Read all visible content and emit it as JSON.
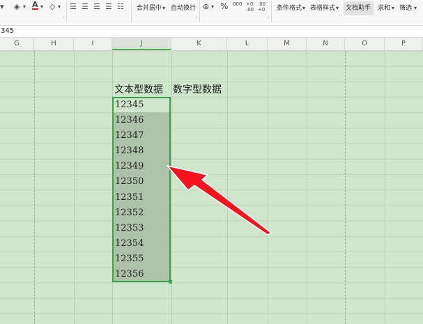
{
  "ribbon": {
    "merge_label": "合并居中",
    "wrap_label": "自动换行",
    "cond_format_label": "条件格式",
    "table_style_label": "表格样式",
    "doc_assistant_label": "文档助手",
    "sum_label": "求和",
    "filter_label": "筛选",
    "font_color_letter": "A",
    "percent": "%",
    "thousands": "000",
    "inc_decimal": "+0 .00",
    "dec_decimal": ".00 +0"
  },
  "formula_bar": {
    "value": "345"
  },
  "columns": [
    "G",
    "H",
    "I",
    "J",
    "K",
    "L",
    "M",
    "N",
    "O",
    "P"
  ],
  "active_column": "J",
  "headers": {
    "text_data": "文本型数据",
    "numeric_data": "数字型数据"
  },
  "cells": [
    "12345",
    "12346",
    "12347",
    "12348",
    "12349",
    "12350",
    "12351",
    "12352",
    "12353",
    "12354",
    "12355",
    "12356"
  ],
  "colors": {
    "sheet_bg": "#cfe6cc",
    "selection": "#3ca247",
    "arrow": "#f5141e"
  }
}
